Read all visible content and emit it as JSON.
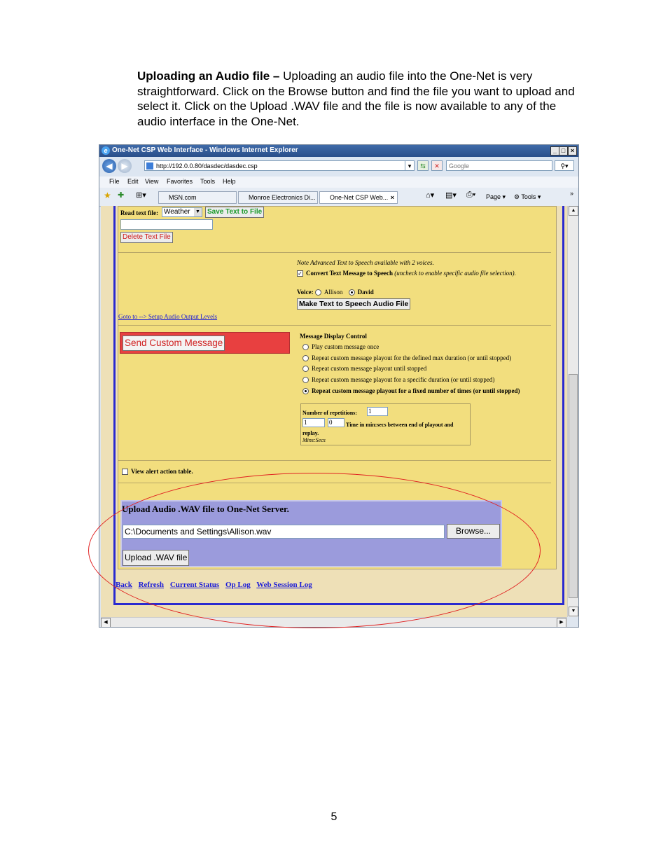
{
  "intro": {
    "heading": "Uploading an Audio file –",
    "body": " Uploading an audio file into the One-Net is very straightforward.  Click on the Browse button and find the file you want to upload and select it.   Click on the Upload .WAV file and the file is now available to any of the audio interface in the One-Net."
  },
  "window": {
    "title": "One-Net CSP Web Interface - Windows Internet Explorer",
    "address": "http://192.0.0.80/dasdec/dasdec.csp",
    "search_placeholder": "Google",
    "menu": [
      "File",
      "Edit",
      "View",
      "Favorites",
      "Tools",
      "Help"
    ],
    "tabs": [
      "MSN.com",
      "Monroe Electronics Di...",
      "One-Net CSP Web..."
    ],
    "toolbar": {
      "page": "Page",
      "tools": "Tools"
    }
  },
  "content": {
    "read_text_label": "Read text file:",
    "read_text_select": "Weather",
    "save_text_button": "Save Text to File",
    "delete_text_button": "Delete Text File",
    "note": "Note Advanced Text to Speech available with 2 voices.",
    "convert_label": "Convert Text Message to Speech",
    "convert_hint": "(uncheck to enable specific audio file selection).",
    "voice_label": "Voice:",
    "voice_allison": "Allison",
    "voice_david": "David",
    "tts_button": "Make Text to Speech Audio File",
    "goto_link": "Goto to --> Setup Audio Output Levels",
    "send_button": "Send Custom Message",
    "display_control_title": "Message Display Control",
    "options": [
      "Play custom message once",
      "Repeat custom message playout for the defined max duration (or until stopped)",
      "Repeat custom message playout until stopped",
      "Repeat custom message playout for a specific duration (or until stopped)",
      "Repeat custom message playout for a fixed number of times (or until stopped)"
    ],
    "selected_option": 4,
    "repetitions_label": "Number of repetitions:",
    "repetitions_value": "1",
    "mins_value": "1",
    "secs_value": "0",
    "time_label": "Time in min:secs between end of playout and replay.",
    "mins_secs_label": "Mins:Secs",
    "alert_table_label": "View alert action table.",
    "upload_title": "Upload Audio .WAV file to One-Net Server.",
    "upload_path": "C:\\Documents and Settings\\Allison.wav",
    "browse_button": "Browse...",
    "upload_button": "Upload .WAV file",
    "nav_links": [
      "Back",
      "Refresh",
      "Current Status",
      "Op Log",
      "Web Session Log"
    ]
  },
  "page_number": "5",
  "colors": {
    "annotation_oval": "#e02020",
    "upload_panel": "#9b9bdc",
    "content_bg": "#f2de7e"
  }
}
